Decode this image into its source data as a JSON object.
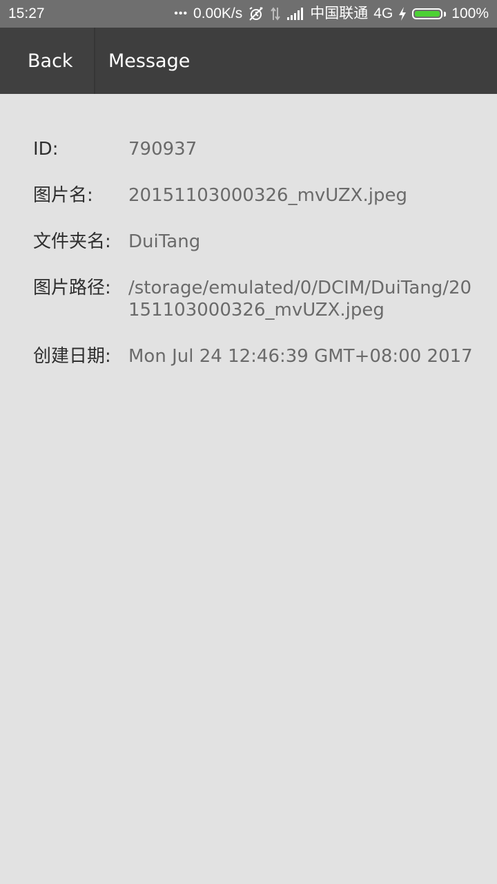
{
  "status_bar": {
    "time": "15:27",
    "more_dots": "•••",
    "net_speed": "0.00K/s",
    "carrier": "中国联通",
    "network_type": "4G",
    "battery_percent": "100%",
    "battery_level": 1.0,
    "battery_color": "#4cd134"
  },
  "toolbar": {
    "back_label": "Back",
    "title": "Message"
  },
  "details": {
    "id_label": "ID:",
    "id_value": "790937",
    "image_name_label": "图片名:",
    "image_name_value": "20151103000326_mvUZX.jpeg",
    "folder_label": "文件夹名:",
    "folder_value": "DuiTang",
    "path_label": "图片路径:",
    "path_value": "/storage/emulated/0/DCIM/DuiTang/20151103000326_mvUZX.jpeg",
    "date_label": "创建日期:",
    "date_value": "Mon Jul 24 12:46:39 GMT+08:00 2017"
  },
  "colors": {
    "status_bar_bg": "#6f6f6f",
    "toolbar_bg": "#3e3e3e",
    "page_bg": "#e2e2e2",
    "label_text": "#2e2e2e",
    "value_text": "#6a6a6a"
  },
  "icons": [
    "more-dots-icon",
    "alarm-off-icon",
    "data-arrows-icon",
    "signal-icon",
    "charging-bolt-icon",
    "battery-icon"
  ]
}
